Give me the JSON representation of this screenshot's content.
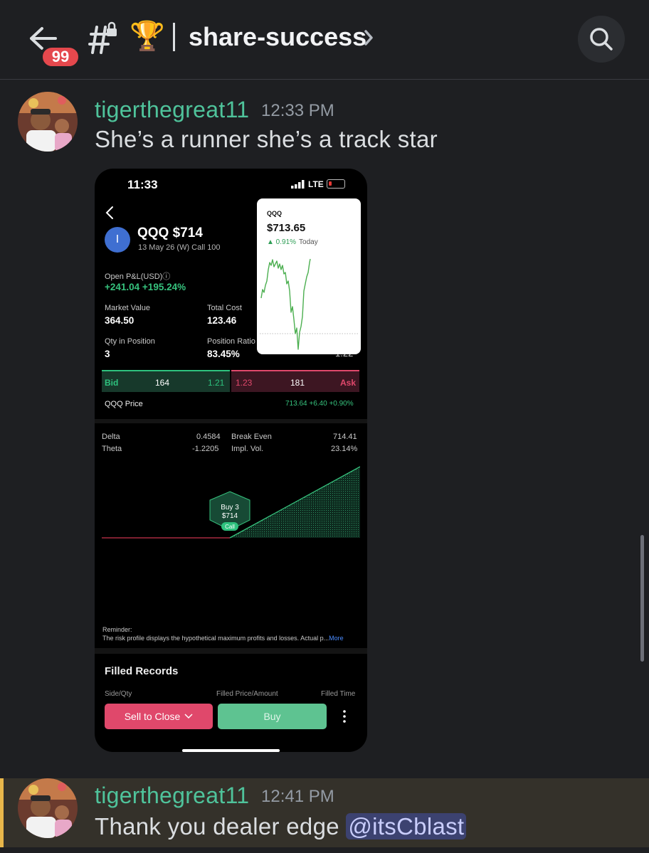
{
  "header": {
    "unread_count": "99",
    "channel_emoji": "🏆",
    "channel_name": "share-success",
    "icons": [
      "back-arrow-icon",
      "locked-channel-icon",
      "chevron-right-icon",
      "search-icon"
    ]
  },
  "messages": [
    {
      "username": "tigerthegreat11",
      "time": "12:33 PM",
      "text": "She’s a runner she’s a track star"
    },
    {
      "username": "tigerthegreat11",
      "time": "12:41 PM",
      "text": "Thank you dealer edge ",
      "mention": "@itsCblast",
      "highlighted": true
    }
  ],
  "attachment": {
    "status_time": "11:33",
    "network": "LTE",
    "logo_letter": "I",
    "symbol_title": "QQQ $714",
    "contract": "13 May 26 (W) Call 100",
    "open_pl_label": "Open P&L(USD)ⓘ",
    "open_pl_value": "+241.04 +195.24%",
    "market_value_label": "Market Value",
    "market_value": "364.50",
    "total_cost_label": "Total Cost",
    "total_cost": "123.46",
    "qty_label": "Qty in Position",
    "qty": "3",
    "position_ratio_label": "Position Ratio",
    "position_ratio": "83.45%",
    "hidden_tail": "1.22",
    "popup": {
      "symbol": "QQQ",
      "price": "$713.65",
      "change": "▲ 0.91%",
      "period": "Today",
      "line_color": "#4caf50"
    },
    "bid_ask": {
      "bid_label": "Bid",
      "bid_size": "164",
      "bid_price": "1.21",
      "ask_price": "1.23",
      "ask_size": "181",
      "ask_label": "Ask"
    },
    "underlying_label": "QQQ Price",
    "underlying_value": "713.64 +6.40 +0.90%",
    "greeks": {
      "delta_label": "Delta",
      "delta": "0.4584",
      "theta_label": "Theta",
      "theta": "-1.2205",
      "break_even_label": "Break Even",
      "break_even": "714.41",
      "iv_label": "Impl. Vol.",
      "iv": "23.14%"
    },
    "risk_marker": {
      "line1": "Buy 3",
      "line2": "$714",
      "tag": "Call"
    },
    "reminder_title": "Reminder:",
    "reminder_text": "The risk profile displays the hypothetical maximum profits and losses. Actual p...",
    "reminder_more": "More",
    "filled_records_title": "Filled Records",
    "columns": [
      "Side/Qty",
      "Filled Price/Amount",
      "Filled Time"
    ],
    "sell_button": "Sell to Close",
    "buy_button": "Buy"
  },
  "colors": {
    "background": "#1e1f22",
    "username": "#4fc39b",
    "badge": "#e5484d",
    "highlight_bar": "#e8b64a",
    "profit_green": "#36c27d",
    "sell_red": "#e0486b",
    "buy_green": "#5ec391"
  }
}
